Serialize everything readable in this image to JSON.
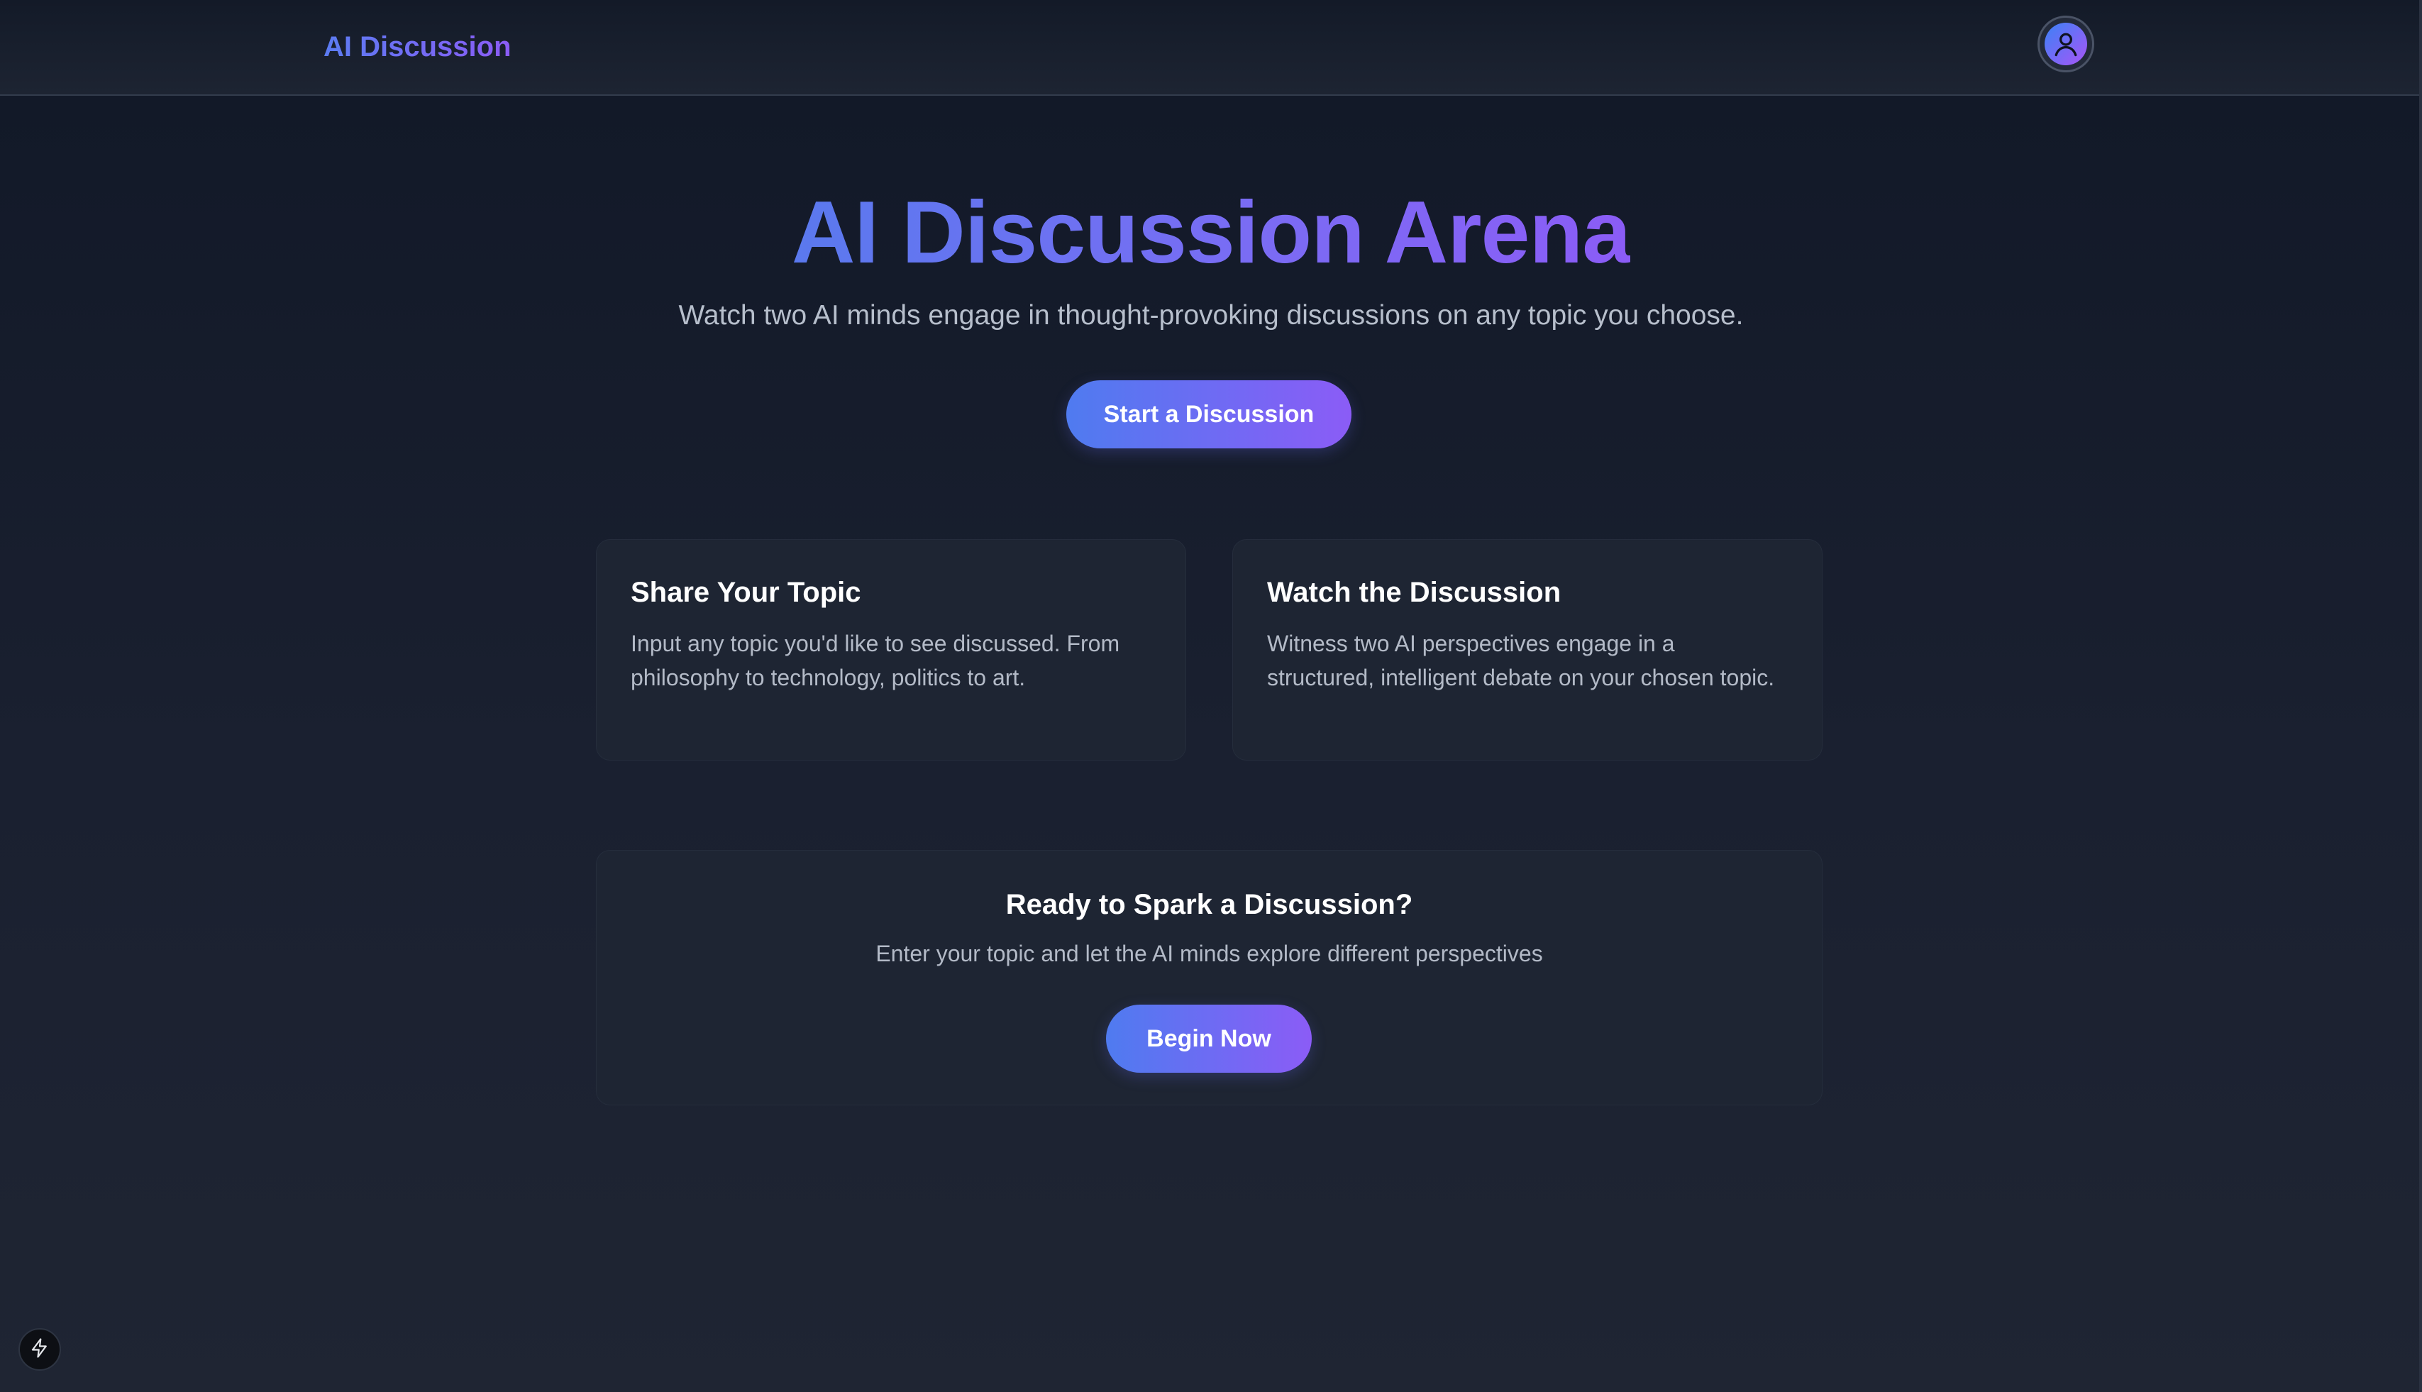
{
  "header": {
    "brand": "AI Discussion",
    "avatar_icon": "user-icon"
  },
  "hero": {
    "title": "AI Discussion Arena",
    "subtitle": "Watch two AI minds engage in thought-provoking discussions on any topic you choose.",
    "cta_label": "Start a Discussion"
  },
  "features": [
    {
      "title": "Share Your Topic",
      "description": "Input any topic you'd like to see discussed. From philosophy to technology, politics to art."
    },
    {
      "title": "Watch the Discussion",
      "description": "Witness two AI perspectives engage in a structured, intelligent debate on your chosen topic."
    }
  ],
  "cta_section": {
    "title": "Ready to Spark a Discussion?",
    "subtitle": "Enter your topic and let the AI minds explore different perspectives",
    "button_label": "Begin Now"
  },
  "footer": {
    "bolt_icon": "lightning-bolt-icon"
  },
  "colors": {
    "accent_start": "#4f7bf0",
    "accent_end": "#8b5cf6",
    "background": "#111827",
    "card": "#1e2533"
  }
}
